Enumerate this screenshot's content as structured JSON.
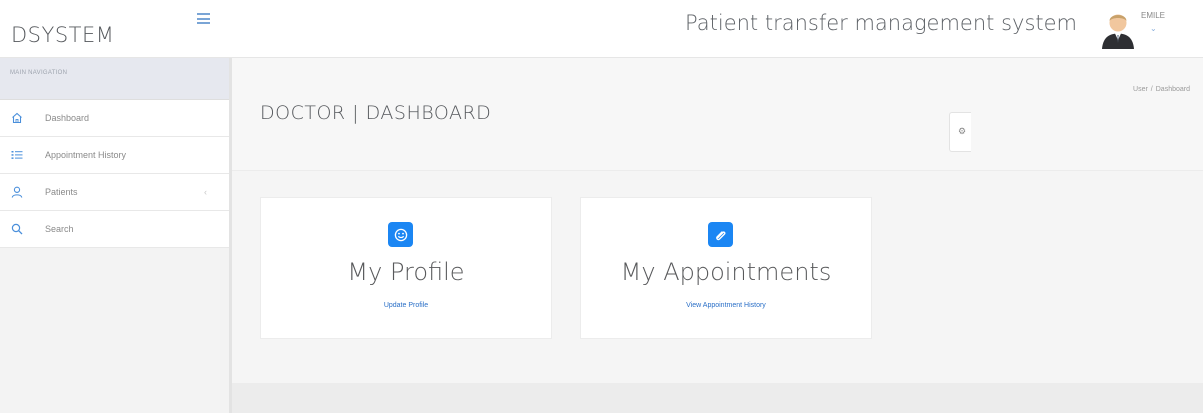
{
  "brand": {
    "name": "DSYSTEM"
  },
  "sidebar": {
    "header": "MAIN NAVIGATION",
    "items": [
      {
        "label": "Dashboard",
        "icon": "home-icon"
      },
      {
        "label": "Appointment History",
        "icon": "list-icon"
      },
      {
        "label": "Patients",
        "icon": "user-icon",
        "caret": "‹"
      },
      {
        "label": "Search",
        "icon": "search-icon"
      }
    ]
  },
  "header": {
    "system_title": "Patient transfer management system",
    "user_name": "EMILE",
    "user_caret": "⌄"
  },
  "page": {
    "title": "DOCTOR | DASHBOARD",
    "breadcrumb": [
      "User",
      "Dashboard"
    ],
    "breadcrumb_sep": "/"
  },
  "cards": [
    {
      "title": "My Profile",
      "link": "Update Profile",
      "icon": "smile-icon"
    },
    {
      "title": "My Appointments",
      "link": "View Appointment History",
      "icon": "paperclip-icon"
    }
  ],
  "colors": {
    "accent": "#1b86f3",
    "link": "#2a6fc7",
    "sidebar_icon": "#4a8fdb"
  }
}
